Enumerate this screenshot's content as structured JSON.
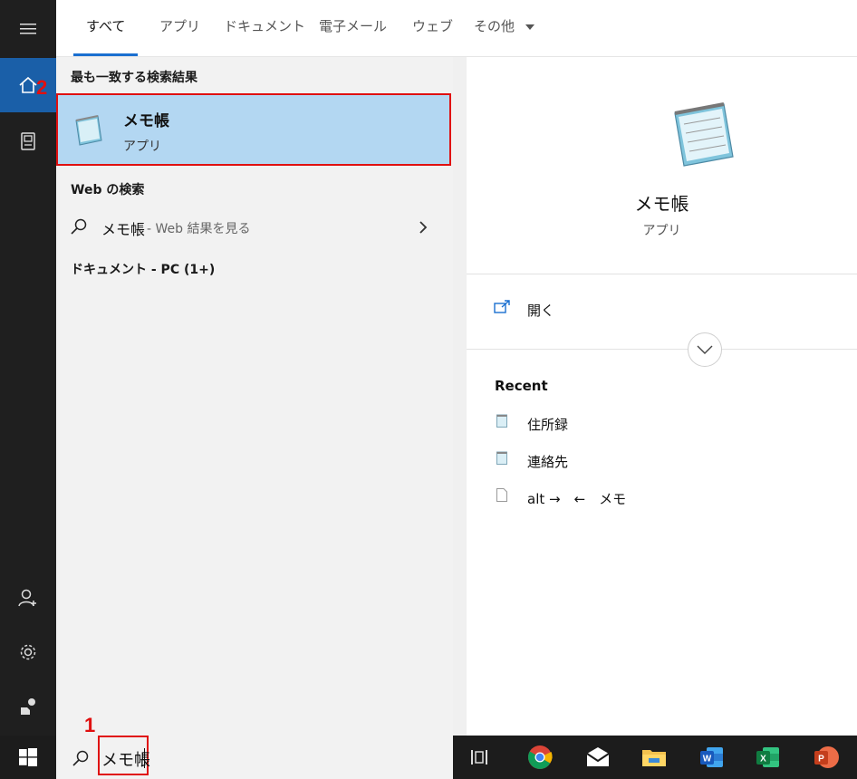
{
  "tabs": [
    {
      "label": "すべて"
    },
    {
      "label": "アプリ"
    },
    {
      "label": "ドキュメント"
    },
    {
      "label": "電子メール"
    },
    {
      "label": "ウェブ"
    },
    {
      "label": "その他"
    }
  ],
  "rail": {
    "icons": [
      "hamburger-icon",
      "home-icon",
      "notebook-icon",
      "person-add-icon",
      "gear-icon",
      "feedback-icon",
      "windows-start-icon"
    ]
  },
  "results": {
    "best_header": "最も一致する検索結果",
    "best_title": "メモ帳",
    "best_subtitle": "アプリ",
    "web_header": "Web の検索",
    "web_query": "メモ帳",
    "web_suffix": " - Web 結果を見る",
    "docs_header": "ドキュメント - PC (1+)"
  },
  "detail": {
    "title": "メモ帳",
    "subtitle": "アプリ",
    "open_label": "開く",
    "recent_header": "Recent",
    "recent_items": [
      {
        "label": "住所録"
      },
      {
        "label": "連絡先"
      },
      {
        "label": "alt →　←　メモ"
      }
    ]
  },
  "search": {
    "value": "メモ帳"
  },
  "annotations": {
    "step1": "1",
    "step2": "2",
    "highlight_color": "#e01010"
  },
  "taskbar": {
    "icons": [
      "task-view-icon",
      "chrome-icon",
      "mail-icon",
      "file-explorer-icon",
      "word-icon",
      "excel-icon",
      "powerpoint-icon"
    ]
  },
  "colors": {
    "accent": "#1a6fd0",
    "selected_bg": "#b3d7f2",
    "rail_bg": "#1f1f1f"
  }
}
